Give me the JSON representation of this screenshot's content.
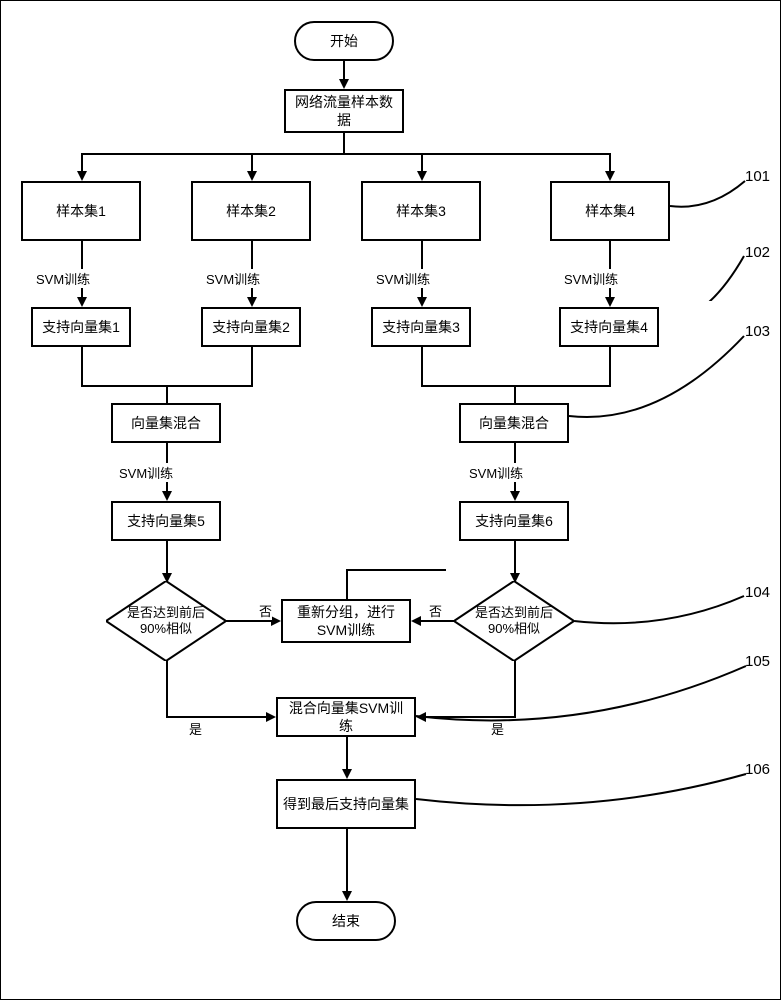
{
  "start": "开始",
  "input_data": "网络流量样本数据",
  "sample1": "样本集1",
  "sample2": "样本集2",
  "sample3": "样本集3",
  "sample4": "样本集4",
  "svm_train": "SVM训练",
  "sv1": "支持向量集1",
  "sv2": "支持向量集2",
  "sv3": "支持向量集3",
  "sv4": "支持向量集4",
  "mix_left": "向量集混合",
  "mix_right": "向量集混合",
  "sv5": "支持向量集5",
  "sv6": "支持向量集6",
  "decision_text": "是否达到前后90%相似",
  "regroup": "重新分组，进行SVM训练",
  "mix_svm": "混合向量集SVM训练",
  "final": "得到最后支持向量集",
  "end": "结束",
  "yes": "是",
  "no": "否",
  "ref101": "101",
  "ref102": "102",
  "ref103": "103",
  "ref104": "104",
  "ref105": "105",
  "ref106": "106"
}
